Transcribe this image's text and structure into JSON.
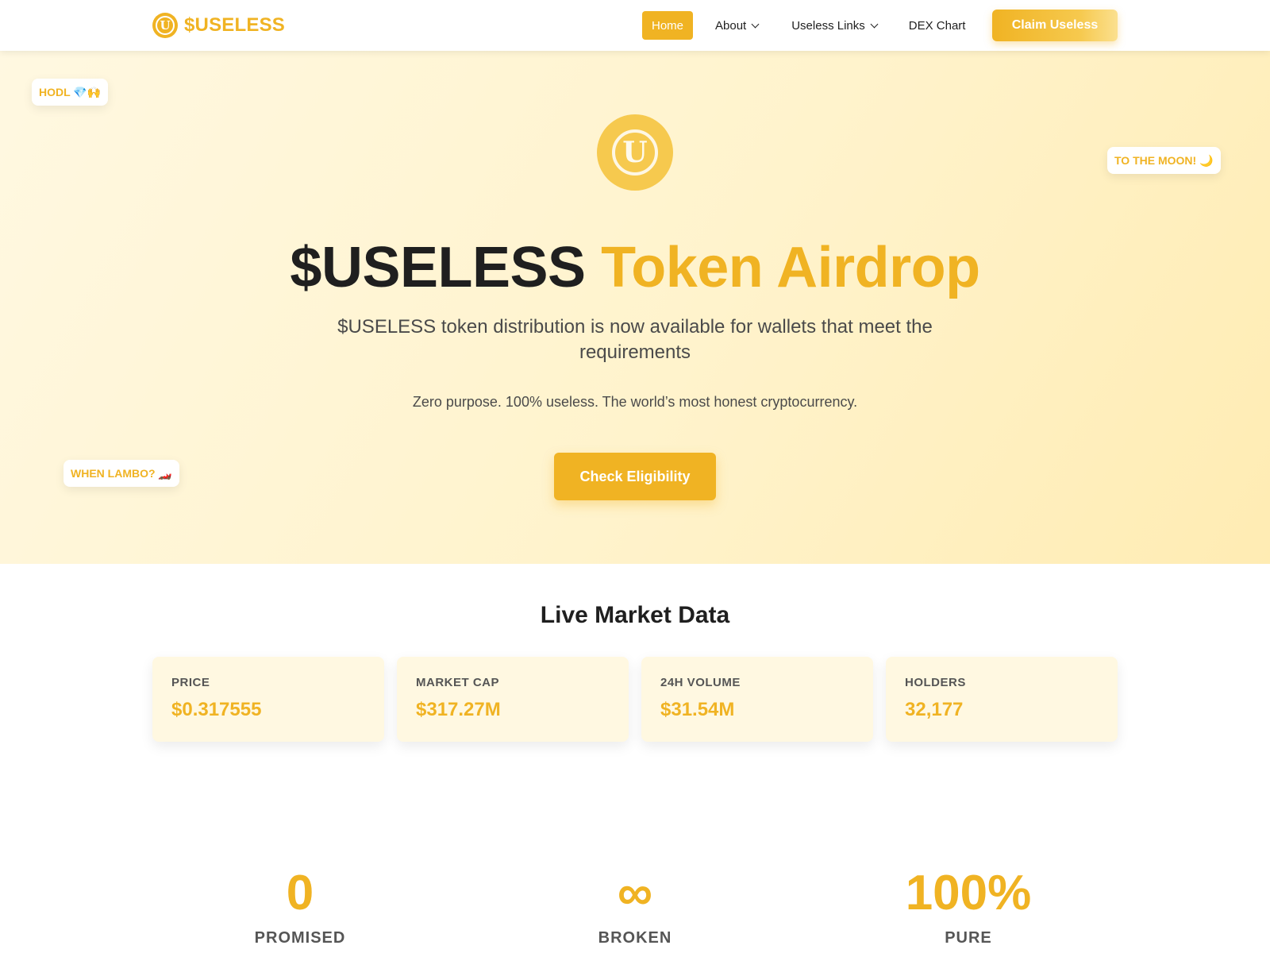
{
  "brand": {
    "name": "$USELESS",
    "icon": "coin-u-icon",
    "letter": "U"
  },
  "nav": {
    "home": "Home",
    "about": "About",
    "links": "Useless Links",
    "dex": "DEX Chart",
    "claim": "Claim Useless"
  },
  "hero": {
    "badges": [
      "HODL 💎🙌",
      "TO THE MOON! 🌙",
      "WHEN LAMBO? 🏎️"
    ],
    "coin_letter": "U",
    "title_main": "$USELESS",
    "title_accent": "Token Airdrop",
    "subtitle": "$USELESS token distribution is now available for wallets that meet the requirements",
    "tagline": "Zero purpose. 100% useless. The world’s most honest cryptocurrency.",
    "cta": "Check Eligibility"
  },
  "market": {
    "title": "Live Market Data",
    "cards": [
      {
        "label": "PRICE",
        "value": "$0.317555"
      },
      {
        "label": "MARKET CAP",
        "value": "$317.27M"
      },
      {
        "label": "24H VOLUME",
        "value": "$31.54M"
      },
      {
        "label": "HOLDERS",
        "value": "32,177"
      }
    ]
  },
  "stats": [
    {
      "value": "0",
      "label": "PROMISED"
    },
    {
      "value": "∞",
      "label": "BROKEN"
    },
    {
      "value": "100%",
      "label": "PURE"
    }
  ],
  "colors": {
    "accent": "#f0b323",
    "hero_bg": "#fff3cc",
    "card_bg": "#fff8e1"
  }
}
